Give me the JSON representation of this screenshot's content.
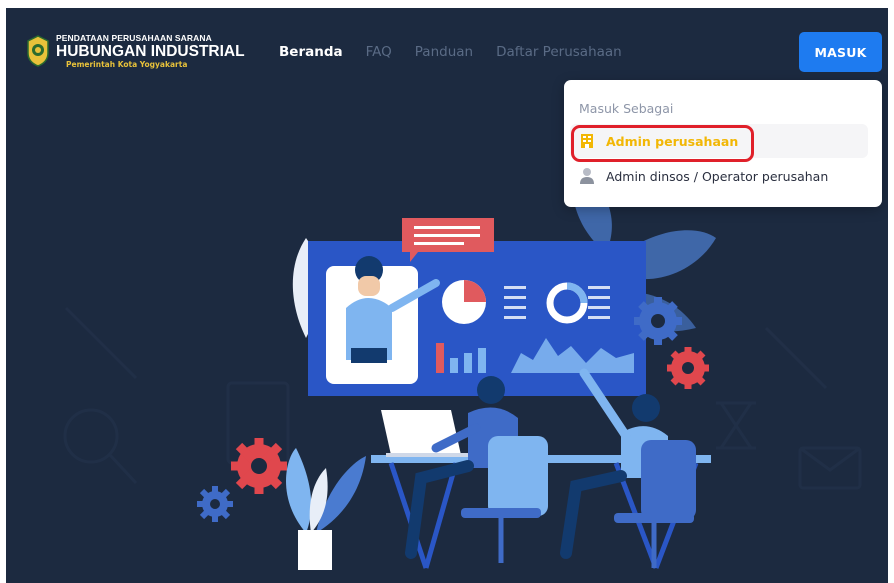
{
  "header": {
    "logo_line1": "PENDATAAN PERUSAHAAN SARANA",
    "logo_line2": "HUBUNGAN INDUSTRIAL",
    "logo_line3": "Pemerintah Kota Yogyakarta"
  },
  "nav": {
    "items": [
      {
        "label": "Beranda",
        "active": true
      },
      {
        "label": "FAQ",
        "active": false
      },
      {
        "label": "Panduan",
        "active": false
      },
      {
        "label": "Daftar Perusahaan",
        "active": false
      }
    ]
  },
  "masuk_button": {
    "label": "MASUK"
  },
  "dropdown": {
    "header": "Masuk Sebagai",
    "items": [
      {
        "label": "Admin perusahaan",
        "icon": "building-icon",
        "selected": true
      },
      {
        "label": "Admin dinsos / Operator perusahan",
        "icon": "user-icon",
        "selected": false
      }
    ]
  },
  "colors": {
    "background": "#1c2a40",
    "primary": "#1e7bf0",
    "accent_yellow": "#f2b705",
    "highlight_red": "#e0202a"
  }
}
